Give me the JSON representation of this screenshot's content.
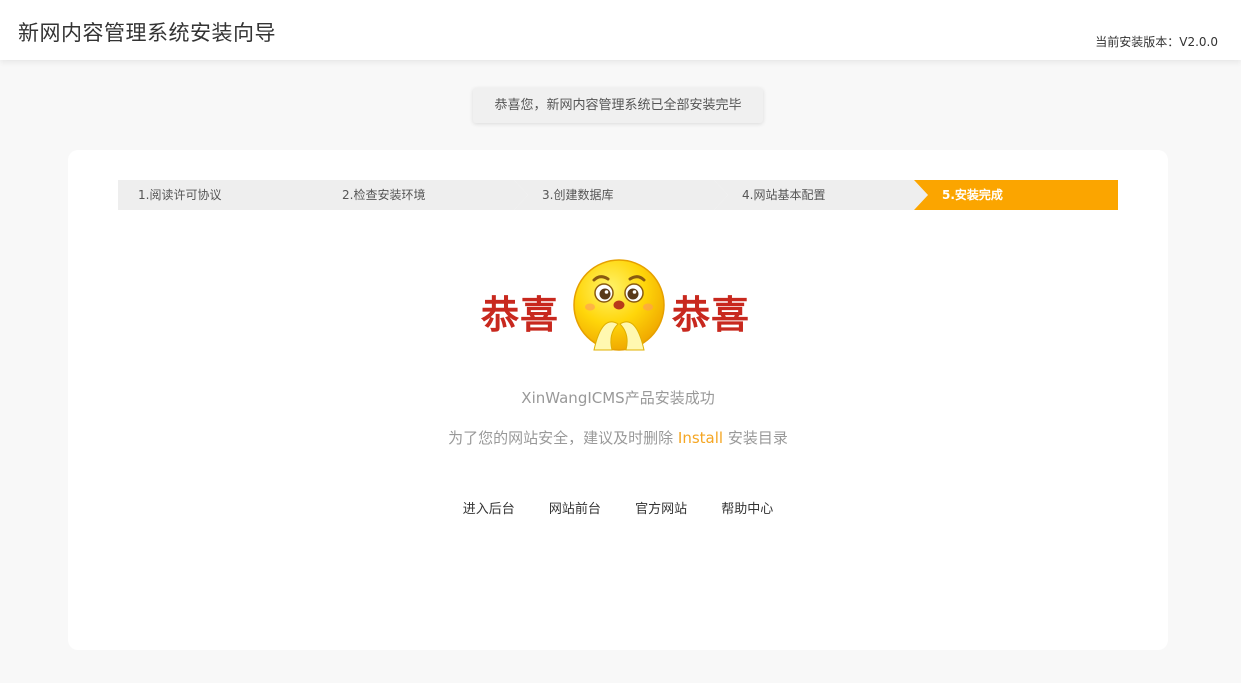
{
  "header": {
    "title": "新网内容管理系统安装向导",
    "version_label": "当前安装版本：",
    "version": "V2.0.0"
  },
  "notice": "恭喜您，新网内容管理系统已全部安装完毕",
  "steps": [
    {
      "label": "1.阅读许可协议",
      "active": false
    },
    {
      "label": "2.检查安装环境",
      "active": false
    },
    {
      "label": "3.创建数据库",
      "active": false
    },
    {
      "label": "4.网站基本配置",
      "active": false
    },
    {
      "label": "5.安装完成",
      "active": true
    }
  ],
  "banner": {
    "left_text": "恭喜",
    "right_text": "恭喜",
    "icon": "smiley-face-icon"
  },
  "success": "XinWangICMS产品安装成功",
  "advice": {
    "before": "为了您的网站安全，建议及时删除 ",
    "highlight": "Install",
    "after": " 安装目录"
  },
  "links": [
    {
      "label": "进入后台"
    },
    {
      "label": "网站前台"
    },
    {
      "label": "官方网站"
    },
    {
      "label": "帮助中心"
    }
  ],
  "colors": {
    "accent": "#fba500",
    "highlight": "#f5a623",
    "congrats_red": "#c8281e"
  }
}
